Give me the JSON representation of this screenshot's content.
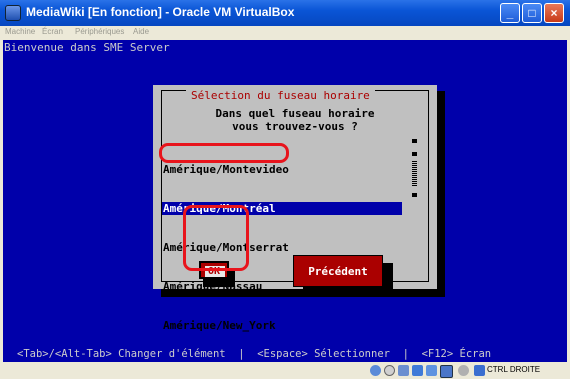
{
  "window": {
    "title": "MediaWiki [En fonction] - Oracle VM VirtualBox",
    "controls": [
      "_",
      "□",
      "×"
    ]
  },
  "menubar": {
    "items": [
      "Machine",
      "Écran",
      "Périphériques",
      "Aide"
    ]
  },
  "console": {
    "welcome": "Bienvenue dans SME Server"
  },
  "dialog": {
    "title": "Sélection du fuseau horaire",
    "prompt": "Dans quel fuseau horaire\nvous trouvez-vous ?",
    "timezones": [
      "Amérique/Montevideo",
      "Amérique/Montréal",
      "Amérique/Montserrat",
      "Amérique/Nassau",
      "Amérique/New_York"
    ],
    "selected_index": 1,
    "ok_label": "OK",
    "previous_label": "Précédent"
  },
  "helpline": {
    "text": "<Tab>/<Alt-Tab> Changer d'élément  |  <Espace> Sélectionner  |  <F12> Écran"
  },
  "statusbar": {
    "host_key": "CTRL DROITE",
    "icons": [
      "harddisk-icon",
      "cdrom-icon",
      "usb-icon",
      "network-icon",
      "shared-folder-icon",
      "display-icon",
      "capture-icon",
      "mouse-integration-icon"
    ]
  },
  "colors": {
    "console_bg": "#0000aa",
    "dialog_bg": "#c0c0c0",
    "title_red": "#aa0000",
    "annotation_red": "#e8141c"
  }
}
